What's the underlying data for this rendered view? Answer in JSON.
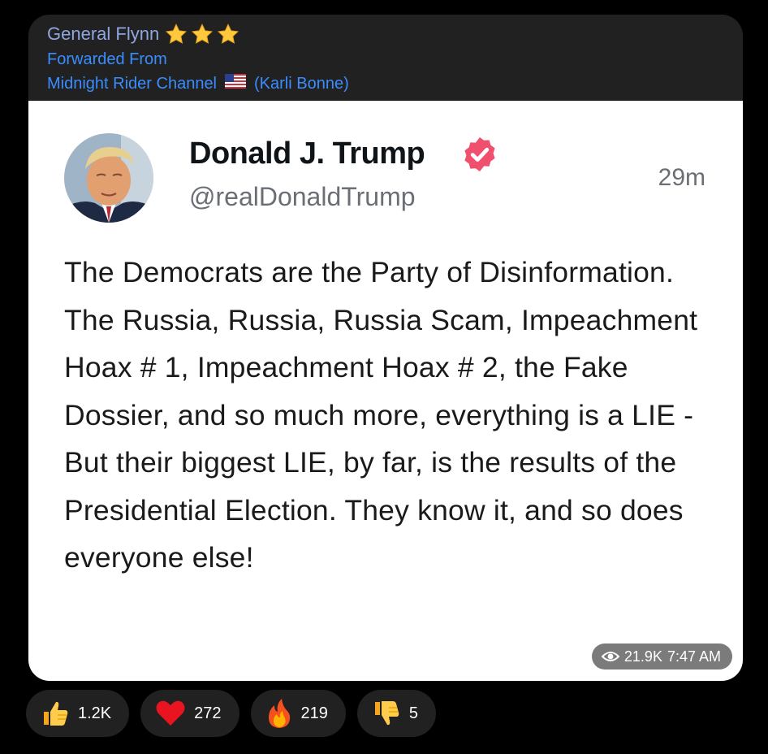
{
  "message": {
    "sender": "General Flynn",
    "forwarded_label": "Forwarded From",
    "channel": "Midnight Rider Channel",
    "channel_author": "(Karli Bonne)"
  },
  "tweet": {
    "author_name": "Donald J. Trump",
    "handle": "@realDonaldTrump",
    "time": "29m",
    "text": "The Democrats are the Party of Disinformation. The Russia, Russia, Russia Scam, Impeachment Hoax # 1, Impeachment Hoax # 2, the Fake Dossier, and so much more, everything is a LIE - But their biggest LIE, by far, is the results of the Presidential Election. They know it, and so does everyone else!"
  },
  "meta": {
    "views": "21.9K",
    "time": "7:47 AM"
  },
  "reactions": [
    {
      "icon": "thumbs-up-icon",
      "count": "1.2K"
    },
    {
      "icon": "heart-icon",
      "count": "272"
    },
    {
      "icon": "fire-icon",
      "count": "219"
    },
    {
      "icon": "thumbs-down-icon",
      "count": "5"
    }
  ],
  "colors": {
    "background": "#000000",
    "bubble": "#212121",
    "sender": "#8fa7e0",
    "link": "#3a8dff",
    "verified": "#f0506e"
  }
}
